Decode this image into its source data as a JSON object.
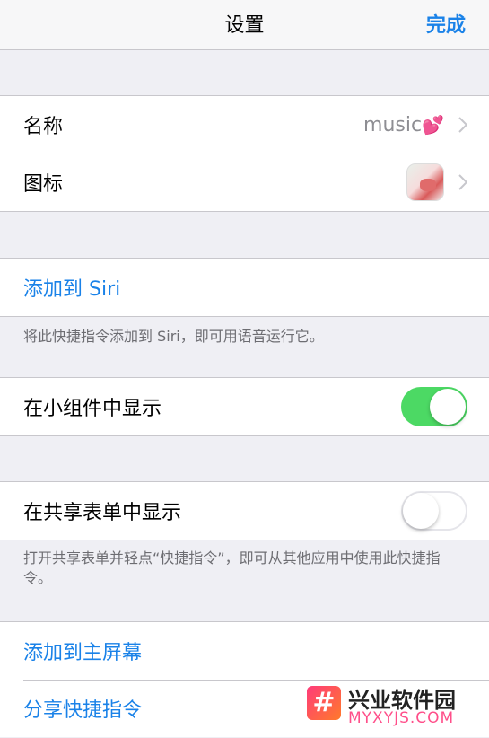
{
  "navbar": {
    "title": "设置",
    "done_label": "完成"
  },
  "name_row": {
    "label": "名称",
    "value": "music",
    "emoji": "💕"
  },
  "icon_row": {
    "label": "图标"
  },
  "siri": {
    "label": "添加到 Siri",
    "footer": "将此快捷指令添加到 Siri，即可用语音运行它。"
  },
  "widget": {
    "label": "在小组件中显示",
    "enabled": true
  },
  "share_sheet": {
    "label": "在共享表单中显示",
    "enabled": false,
    "footer": "打开共享表单并轻点“快捷指令”，即可从其他应用中使用此快捷指令。"
  },
  "actions": {
    "home_screen_label": "添加到主屏幕",
    "share_label": "分享快捷指令"
  },
  "watermark": {
    "logo_char": "#",
    "title": "兴业软件园",
    "subtitle": "MYXYJS.COM"
  },
  "colors": {
    "accent": "#1a82e8",
    "switch_on": "#4cd964",
    "background": "#efeff4"
  }
}
